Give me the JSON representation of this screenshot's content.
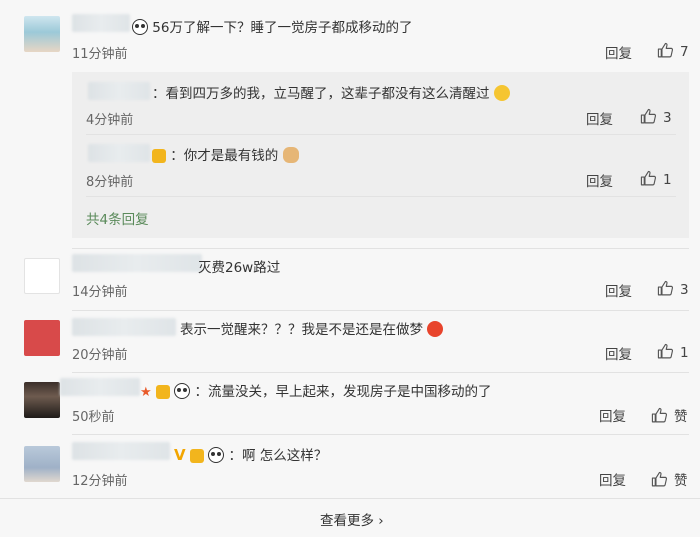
{
  "comments": [
    {
      "text": "56万了解一下？睡了一觉房子都成移动的了",
      "time": "11分钟前",
      "reply": "回复",
      "likes": "7"
    },
    {
      "text": "灭费26w路过",
      "time": "14分钟前",
      "reply": "回复",
      "likes": "3"
    },
    {
      "text": "表示一觉醒来？？？我是不是还是在做梦",
      "time": "20分钟前",
      "reply": "回复",
      "likes": "1"
    },
    {
      "text": "：流量没关，早上起来，发现房子是中国移动的了",
      "time": "50秒前",
      "reply": "回复",
      "likes": "赞"
    },
    {
      "text": "：啊 怎么这样？",
      "time": "12分钟前",
      "reply": "回复",
      "likes": "赞"
    }
  ],
  "subreplies": [
    {
      "text": "：看到四万多的我，立马醒了，这辈子都没有这么清醒过",
      "time": "4分钟前",
      "reply": "回复",
      "likes": "3"
    },
    {
      "text": "：你才是最有钱的",
      "time": "8分钟前",
      "reply": "回复",
      "likes": "1"
    }
  ],
  "subreply_total": "共4条回复",
  "view_more": "查看更多 ›",
  "icons": {
    "thumb": "thumbs-up-icon",
    "panda": "panda-emoji-icon",
    "cry": "laugh-cry-emoji-icon",
    "cat": "cat-emoji-icon",
    "angry": "angry-emoji-icon"
  },
  "colors": {
    "link": "#5a8a5a",
    "bg": "#f7f7f7",
    "subbox": "#eeeeee"
  }
}
